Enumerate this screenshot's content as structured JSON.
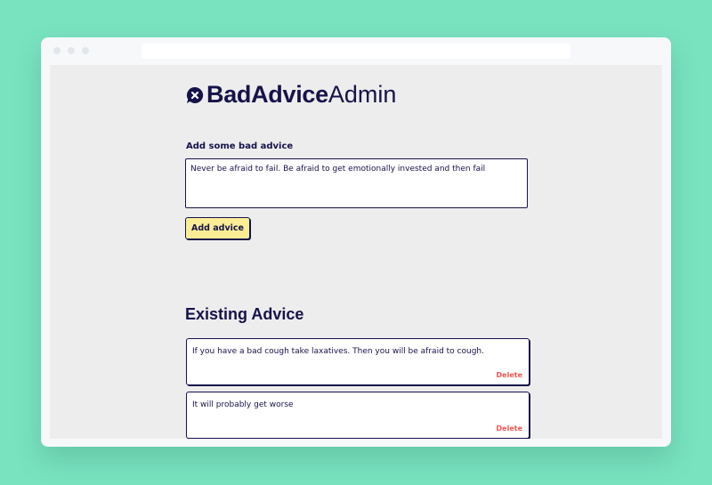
{
  "app": {
    "brand_bold": "BadAdvice",
    "brand_light": "Admin",
    "logo_icon": "speech-bubble-x-icon"
  },
  "form": {
    "label": "Add some bad advice",
    "input_value": "Never be afraid to fail. Be afraid to get emotionally invested and then fail",
    "submit_label": "Add advice"
  },
  "existing": {
    "title": "Existing Advice",
    "items": [
      {
        "text": "If you have a bad cough take laxatives. Then you will be afraid to cough.",
        "delete_label": "Delete"
      },
      {
        "text": "It will probably get worse",
        "delete_label": "Delete"
      }
    ]
  },
  "colors": {
    "background": "#79e2bf",
    "page": "#ededed",
    "ink": "#16124a",
    "button": "#fbed96",
    "delete": "#f2554f"
  }
}
